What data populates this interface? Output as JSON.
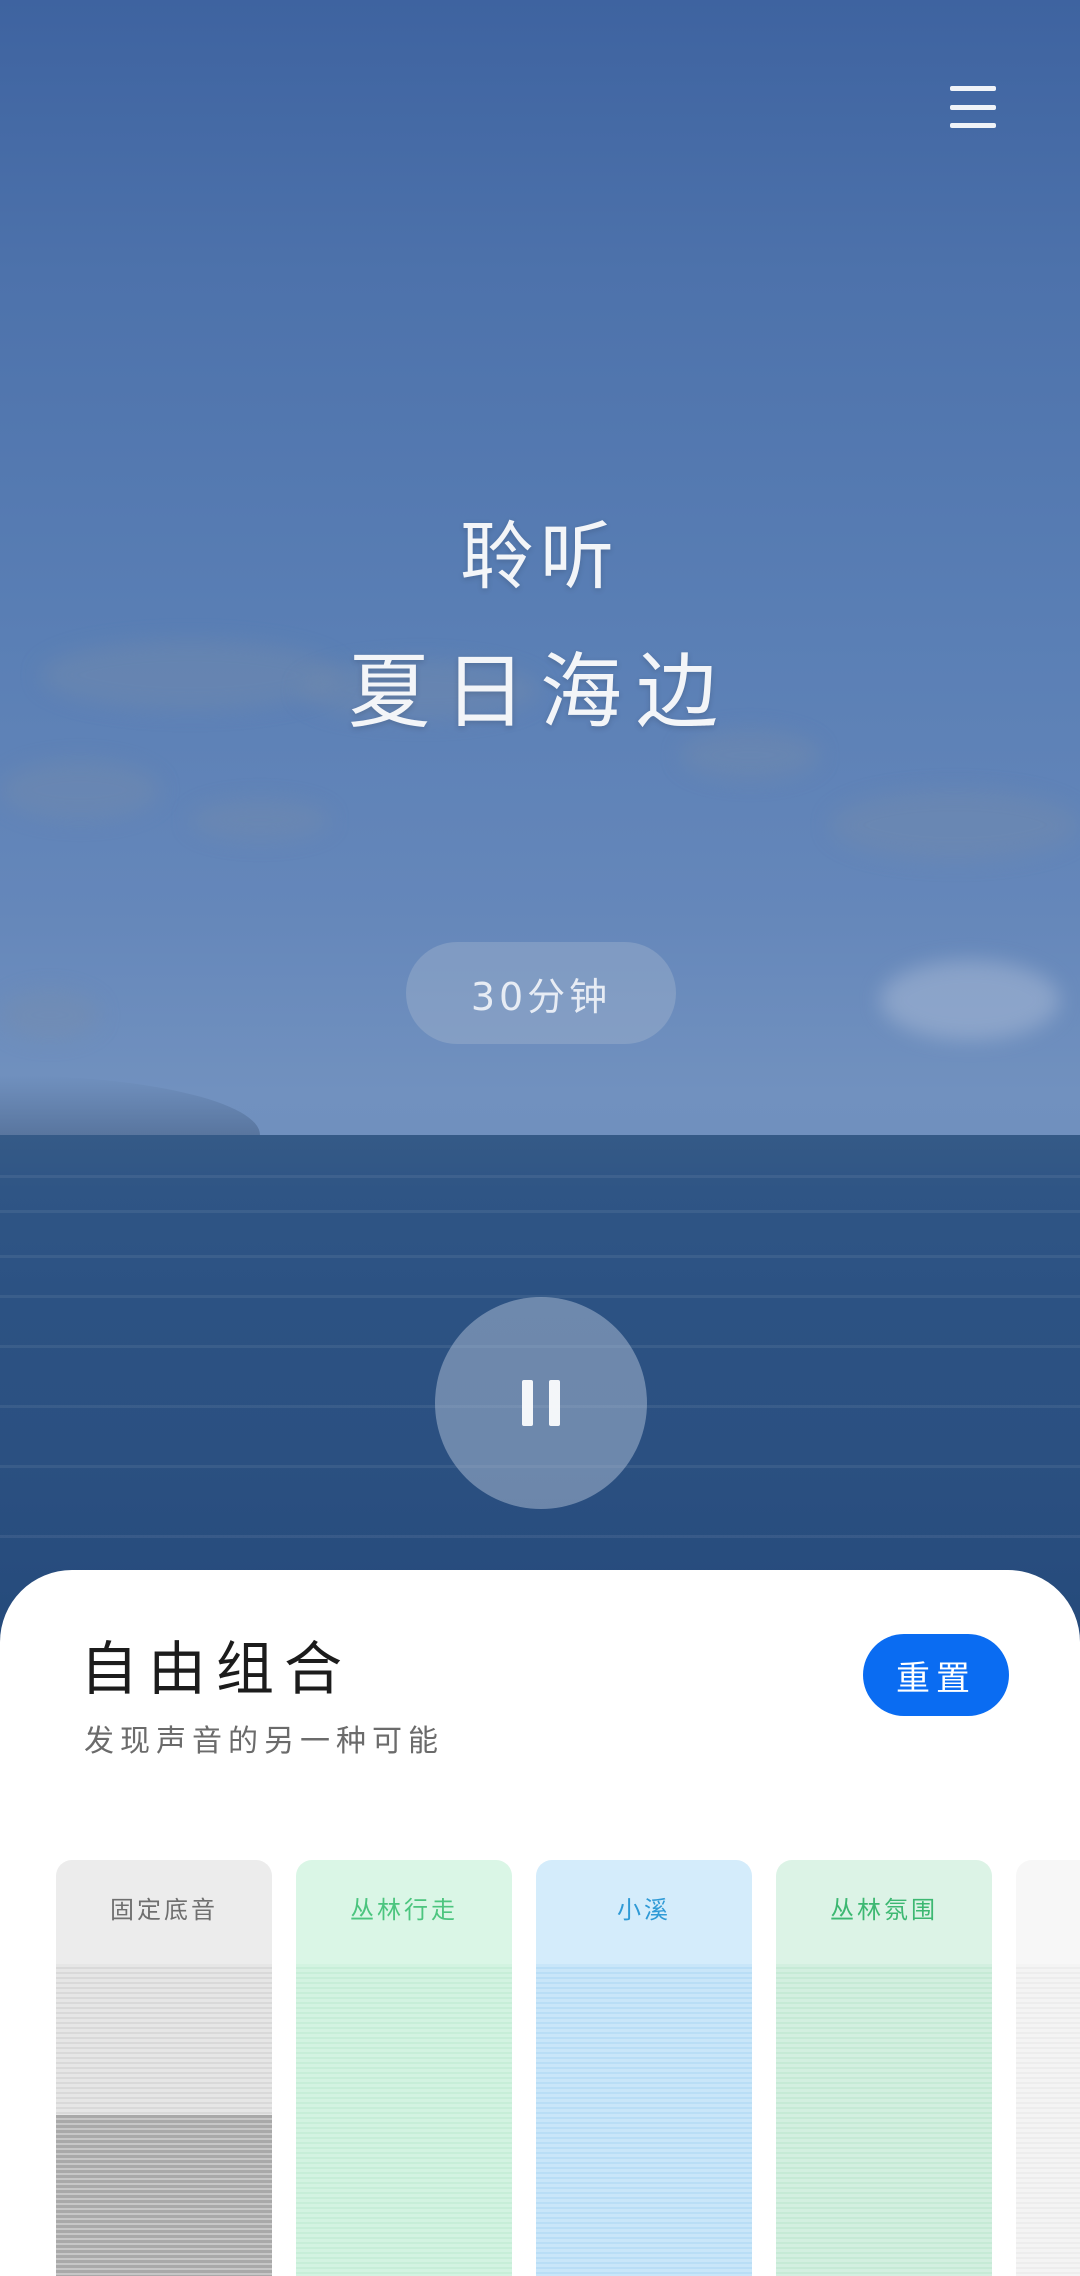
{
  "hero": {
    "title_line1": "聆听",
    "title_line2": "夏日海边",
    "duration": "30分钟"
  },
  "icons": {
    "menu": "hamburger-menu-icon",
    "pause": "pause-icon"
  },
  "panel": {
    "title": "自由组合",
    "subtitle": "发现声音的另一种可能",
    "reset_label": "重置",
    "accent": "#0a6cf2"
  },
  "sound_cards": [
    {
      "label": "固定底音",
      "color": "#6f6f6f",
      "volume_level": 0.55
    },
    {
      "label": "丛林行走",
      "color": "#4cc57f",
      "volume_level": 0
    },
    {
      "label": "小溪",
      "color": "#2f9ad6",
      "volume_level": 0
    },
    {
      "label": "丛林氛围",
      "color": "#3db872",
      "volume_level": 0
    },
    {
      "label": "",
      "color": "#bdbdbd",
      "volume_level": 0
    }
  ]
}
